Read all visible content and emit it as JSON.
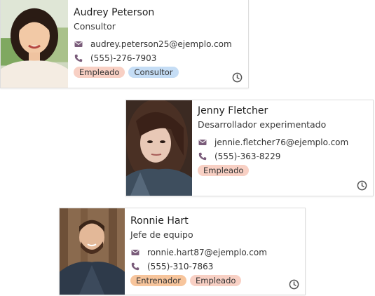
{
  "contacts": [
    {
      "name": "Audrey Peterson",
      "role": "Consultor",
      "email": "audrey.peterson25@ejemplo.com",
      "phone": "(555)-276-7903",
      "tags": [
        "Empleado",
        "Consultor"
      ]
    },
    {
      "name": "Jenny Fletcher",
      "role": "Desarrollador experimentado",
      "email": "jennie.fletcher76@ejemplo.com",
      "phone": "(555)-363-8229",
      "tags": [
        "Empleado"
      ]
    },
    {
      "name": "Ronnie Hart",
      "role": "Jefe de equipo",
      "email": "ronnie.hart87@ejemplo.com",
      "phone": "(555)-310-7863",
      "tags": [
        "Entrenador",
        "Empleado"
      ]
    }
  ],
  "icons": {
    "email": "envelope-icon",
    "phone": "phone-icon",
    "activity": "clock-icon"
  },
  "colors": {
    "icon": "#7a5c7a",
    "tag_empleado": "#f8d0c4",
    "tag_consultor": "#c5ddf5",
    "tag_entrenador": "#f7c59c"
  }
}
